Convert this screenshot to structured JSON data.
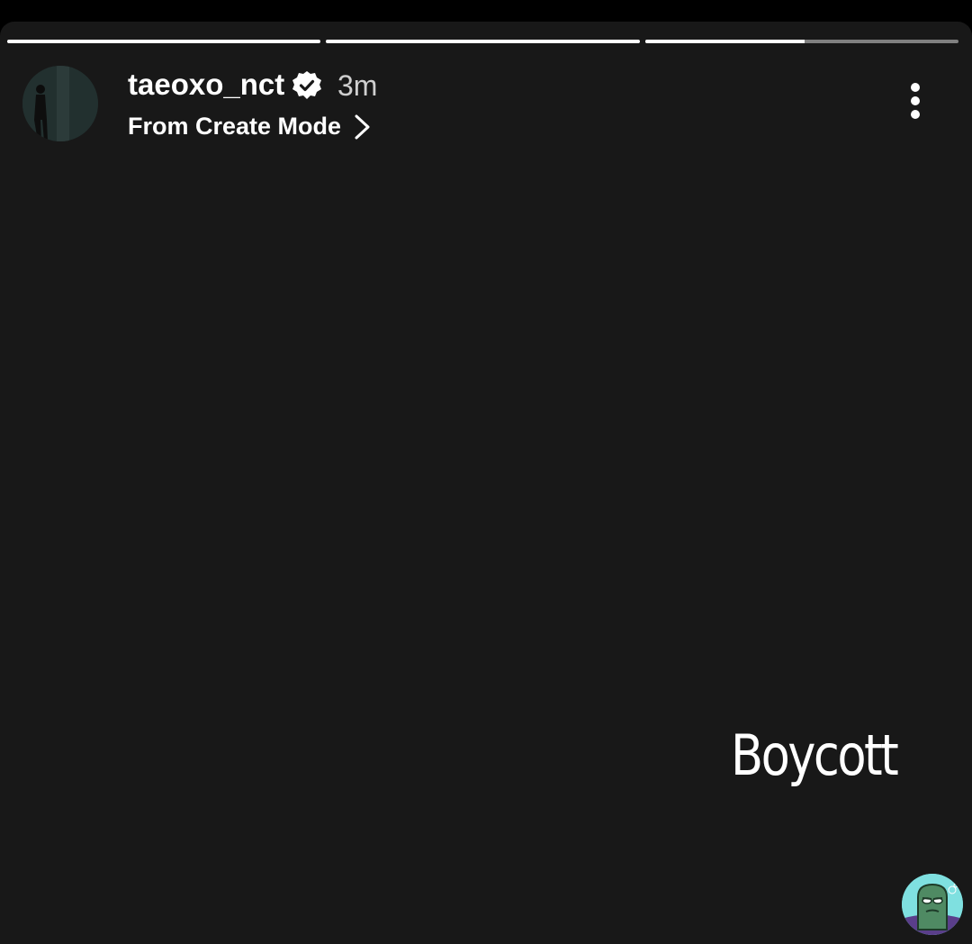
{
  "story": {
    "progress_segments": [
      {
        "fill_fraction": 1.0
      },
      {
        "fill_fraction": 1.0
      },
      {
        "fill_fraction": 0.51
      }
    ],
    "username": "taeoxo_nct",
    "verified_icon": "verified-badge-icon",
    "time_ago": "3m",
    "source_label": "From Create Mode",
    "source_chevron_icon": "chevron-right-icon",
    "more_icon": "more-vertical-icon",
    "text": "Boycott",
    "background_color": "#181818",
    "sticker_icon": "fish-character-sticker-icon"
  }
}
